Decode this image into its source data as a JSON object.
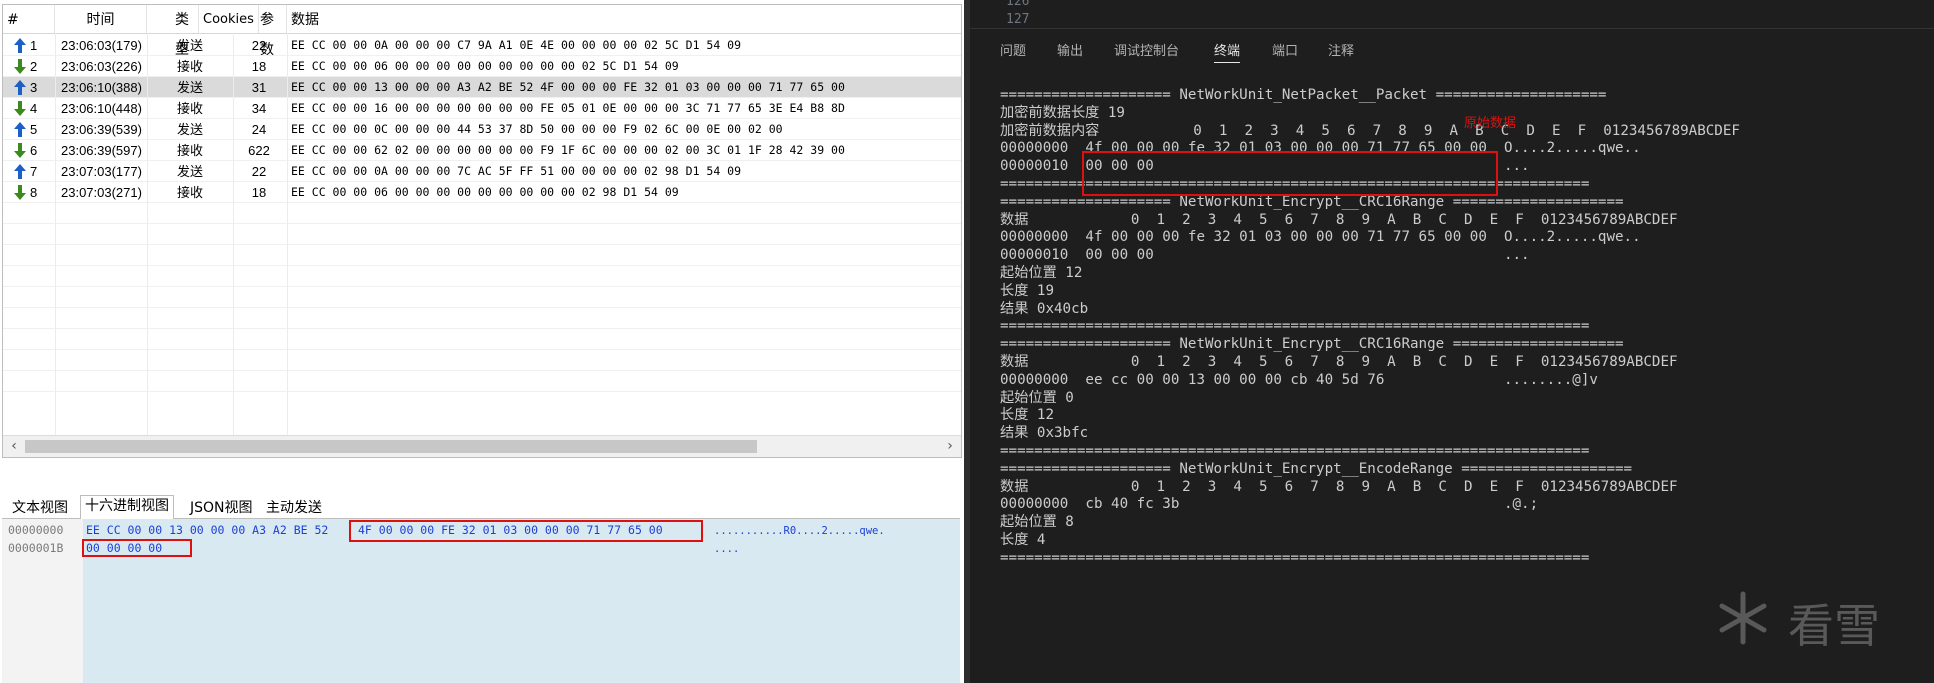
{
  "packet_table": {
    "columns": [
      "#",
      "时间",
      "类型",
      "Cookies",
      "参数",
      "数据"
    ],
    "rows": [
      {
        "num": "1",
        "time": "23:06:03(179)",
        "type": "发送",
        "len": "22",
        "data": "EE CC 00 00 0A 00 00 00 C7 9A A1 0E 4E 00 00 00 00 02 5C D1 54 09",
        "dir": "up"
      },
      {
        "num": "2",
        "time": "23:06:03(226)",
        "type": "接收",
        "len": "18",
        "data": "EE CC 00 00 06 00 00 00 00 00 00 00 00 00 02 5C D1 54 09",
        "dir": "down"
      },
      {
        "num": "3",
        "time": "23:06:10(388)",
        "type": "发送",
        "len": "31",
        "data": "EE CC 00 00 13 00 00 00 A3 A2 BE 52 4F 00 00 00 FE 32 01 03 00 00 00 71 77 65 00",
        "dir": "up"
      },
      {
        "num": "4",
        "time": "23:06:10(448)",
        "type": "接收",
        "len": "34",
        "data": "EE CC 00 00 16 00 00 00 00 00 00 00 FE 05 01 0E 00 00 00 3C 71 77 65 3E E4 B8 8D",
        "dir": "down"
      },
      {
        "num": "5",
        "time": "23:06:39(539)",
        "type": "发送",
        "len": "24",
        "data": "EE CC 00 00 0C 00 00 00 44 53 37 8D 50 00 00 00 F9 02 6C 00 0E 00 02 00",
        "dir": "up"
      },
      {
        "num": "6",
        "time": "23:06:39(597)",
        "type": "接收",
        "len": "622",
        "data": "EE CC 00 00 62 02 00 00 00 00 00 00 F9 1F 6C 00 00 00 02 00 3C 01 1F 28 42 39 00",
        "dir": "down"
      },
      {
        "num": "7",
        "time": "23:07:03(177)",
        "type": "发送",
        "len": "22",
        "data": "EE CC 00 00 0A 00 00 00 7C AC 5F FF 51 00 00 00 00 02 98 D1 54 09",
        "dir": "up"
      },
      {
        "num": "8",
        "time": "23:07:03(271)",
        "type": "接收",
        "len": "18",
        "data": "EE CC 00 00 06 00 00 00 00 00 00 00 00 00 02 98 D1 54 09",
        "dir": "down"
      }
    ],
    "selected_row": 3
  },
  "bottom_tabs": [
    "文本视图",
    "十六进制视图",
    "JSON视图",
    "主动发送"
  ],
  "hex_view": {
    "offsets": [
      "00000000",
      "0000001B"
    ],
    "line1_a": "EE CC 00 00 13 00 00 00 A3 A2 BE 52",
    "line1_b": "4F 00 00 00 FE 32 01 03 00 00 00 71 77 65 00",
    "line2": "00 00 00 00",
    "ascii1": "...........R0....2.....qwe.",
    "ascii2": "...."
  },
  "editor": {
    "line_numbers": [
      "126",
      "127"
    ]
  },
  "panel_tabs": [
    "问题",
    "输出",
    "调试控制台",
    "终端",
    "端口",
    "注释"
  ],
  "active_panel_tab": "终端",
  "terminal": {
    "annotation": "原始数据",
    "lines": [
      "==================== NetWorkUnit_NetPacket__Packet ====================",
      "加密前数据长度 19",
      "加密前数据内容           0  1  2  3  4  5  6  7  8  9  A  B  C  D  E  F  0123456789ABCDEF",
      "00000000  4f 00 00 00 fe 32 01 03 00 00 00 71 77 65 00 00  O....2.....qwe..",
      "00000010  00 00 00                                         ...",
      "=====================================================================",
      "==================== NetWorkUnit_Encrypt__CRC16Range ====================",
      "数据            0  1  2  3  4  5  6  7  8  9  A  B  C  D  E  F  0123456789ABCDEF",
      "00000000  4f 00 00 00 fe 32 01 03 00 00 00 71 77 65 00 00  O....2.....qwe..",
      "00000010  00 00 00                                         ...",
      "起始位置 12",
      "长度 19",
      "结果 0x40cb",
      "=====================================================================",
      "==================== NetWorkUnit_Encrypt__CRC16Range ====================",
      "数据            0  1  2  3  4  5  6  7  8  9  A  B  C  D  E  F  0123456789ABCDEF",
      "00000000  ee cc 00 00 13 00 00 00 cb 40 5d 76              ........@]v",
      "起始位置 0",
      "长度 12",
      "结果 0x3bfc",
      "=====================================================================",
      "==================== NetWorkUnit_Encrypt__EncodeRange ====================",
      "数据            0  1  2  3  4  5  6  7  8  9  A  B  C  D  E  F  0123456789ABCDEF",
      "00000000  cb 40 fc 3b                                      .@.;",
      "起始位置 8",
      "长度 4",
      "====================================================================="
    ]
  },
  "watermark_text": "看雪",
  "colors": {
    "up_arrow": "#1c5fc9",
    "down_arrow": "#3a8a1e",
    "hex_blue": "#1a3fd6",
    "highlight_red": "#e01010",
    "terminal_bg": "#1e1e1e"
  }
}
